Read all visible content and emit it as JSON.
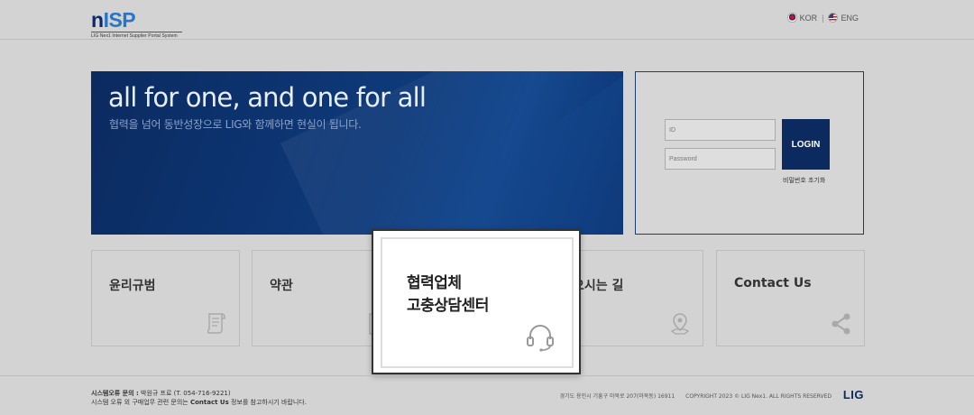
{
  "header": {
    "logo_n": "n",
    "logo_isp": "ISP",
    "logo_sub": "LIG Nex1 Internet Supplier Portal System",
    "lang_kor": "KOR",
    "lang_sep": "|",
    "lang_eng": "ENG"
  },
  "banner": {
    "title": "all for one, and one for all",
    "subtitle": "협력을 넘어 동반성장으로 LIG와 함께하면 현실이 됩니다."
  },
  "login": {
    "id_placeholder": "ID",
    "pw_placeholder": "Password",
    "button": "LOGIN",
    "reset": "비밀번호 초기화"
  },
  "cards": [
    {
      "title": "윤리규범",
      "icon": "scroll-icon"
    },
    {
      "title": "약관",
      "icon": "document-icon"
    },
    {
      "title": "오시는 길",
      "icon": "map-pin-icon"
    },
    {
      "title": "Contact Us",
      "icon": "share-icon"
    }
  ],
  "popup": {
    "line1": "협력업체",
    "line2": "고충상담센터",
    "icon": "headset-icon"
  },
  "footer": {
    "line1_label": "시스템오류 문의 :",
    "line1_value": "박원규 프로 (T. 054-716-9221)",
    "line2_pre": "시스템 오류 외 구매업무 관련 문의는",
    "line2_link": "Contact Us",
    "line2_post": "정보를 참고하시기 바랍니다.",
    "address": "경기도 용인시 기흥구 마북로 207(마북동) 16911",
    "copyright": "COPYRIGHT 2023 © LIG Nex1. ALL RIGHTS RESERVED",
    "logo": "LIG"
  },
  "colors": {
    "navy": "#0b2a60",
    "accent_blue": "#2a74c6"
  }
}
